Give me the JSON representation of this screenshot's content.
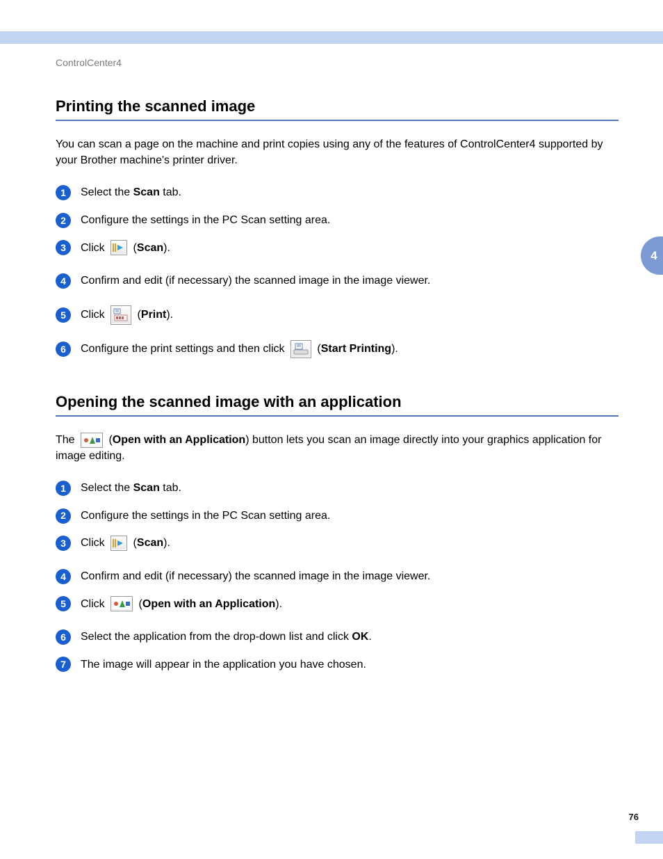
{
  "breadcrumb": "ControlCenter4",
  "side_tab": "4",
  "page_number": "76",
  "sec1": {
    "heading": "Printing the scanned image",
    "intro": "You can scan a page on the machine and print copies using any of the features of ControlCenter4 supported by your Brother machine's printer driver.",
    "s1a": "Select the ",
    "s1b": "Scan",
    "s1c": " tab.",
    "s2": "Configure the settings in the PC Scan setting area.",
    "s3a": "Click ",
    "s3b": "Scan",
    "s4": "Confirm and edit (if necessary) the scanned image in the image viewer.",
    "s5a": "Click ",
    "s5b": "Print",
    "s6a": "Configure the print settings and then click ",
    "s6b": "Start Printing"
  },
  "sec2": {
    "heading": "Opening the scanned image with an application",
    "intro_a": "The ",
    "intro_b": "Open with an Application",
    "intro_c": ") button lets you scan an image directly into your graphics application for image editing.",
    "s1a": "Select the ",
    "s1b": "Scan",
    "s1c": " tab.",
    "s2": "Configure the settings in the PC Scan setting area.",
    "s3a": "Click ",
    "s3b": "Scan",
    "s4": "Confirm and edit (if necessary) the scanned image in the image viewer.",
    "s5a": "Click ",
    "s5b": "Open with an Application",
    "s6a": "Select the application from the drop-down list and click ",
    "s6b": "OK",
    "s7": "The image will appear in the application you have chosen."
  }
}
